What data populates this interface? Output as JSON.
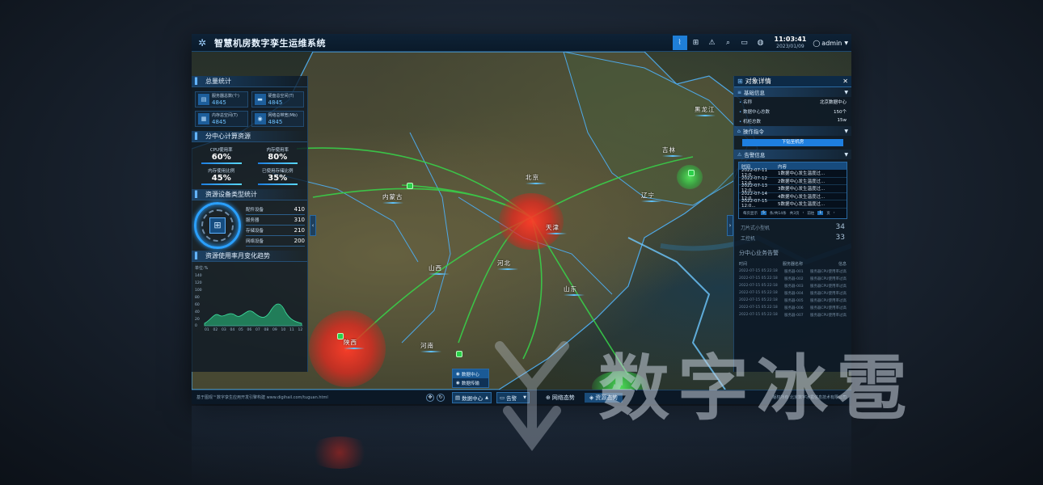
{
  "app": {
    "title": "智慧机房数字孪生运维系统",
    "time": "11:03:41",
    "date": "2023/01/09",
    "user": "admin"
  },
  "left": {
    "total_stats": {
      "heading": "总量统计",
      "items": [
        {
          "label": "服务器总数(个)",
          "value": "4845",
          "icon": "server-icon"
        },
        {
          "label": "硬盘总空间(T)",
          "value": "4845",
          "icon": "disk-icon"
        },
        {
          "label": "内存总空间(T)",
          "value": "4845",
          "icon": "memory-icon"
        },
        {
          "label": "网络总带宽(Mb)",
          "value": "4845",
          "icon": "network-icon"
        }
      ]
    },
    "compute": {
      "heading": "分中心计算资源",
      "items": [
        {
          "label": "CPU使用率",
          "value": "60%"
        },
        {
          "label": "内存使用率",
          "value": "80%"
        },
        {
          "label": "内存使用比例",
          "value": "45%"
        },
        {
          "label": "已使用存储比例",
          "value": "35%"
        }
      ]
    },
    "device_types": {
      "heading": "资源设备类型统计",
      "items": [
        {
          "label": "配件设备",
          "value": "410"
        },
        {
          "label": "服务器",
          "value": "310"
        },
        {
          "label": "存储设备",
          "value": "210"
        },
        {
          "label": "网络设备",
          "value": "200"
        }
      ]
    },
    "trend": {
      "heading": "资源使用率月变化趋势",
      "unit": "单位:%",
      "y_ticks": [
        "140",
        "120",
        "100",
        "80",
        "60",
        "40",
        "20",
        "0"
      ],
      "x_ticks": [
        "01",
        "02",
        "03",
        "04",
        "05",
        "06",
        "07",
        "08",
        "09",
        "10",
        "11",
        "12"
      ]
    }
  },
  "right": {
    "heading": "对象详情",
    "basic": {
      "heading": "基础信息",
      "rows": [
        {
          "k": "名称",
          "v": "北京数据中心"
        },
        {
          "k": "数据中心总数",
          "v": "150个"
        },
        {
          "k": "机柜总数",
          "v": "15w"
        }
      ]
    },
    "command": {
      "heading": "操作指令",
      "button": "下钻至机房"
    },
    "alarm": {
      "heading": "告警信息",
      "columns": [
        "时间",
        "内容"
      ],
      "rows": [
        [
          "2022-07-11 12:0...",
          "1数据中心发生温度过..."
        ],
        [
          "2022-07-12 12:0...",
          "2数据中心发生温度过..."
        ],
        [
          "2022-07-13 12:0...",
          "3数据中心发生温度过..."
        ],
        [
          "2022-07-14 12:0...",
          "4数据中心发生温度过..."
        ],
        [
          "2022-07-15 12:0...",
          "5数据中心发生温度过..."
        ]
      ],
      "pager": {
        "per_page": "每页显示",
        "size": "5",
        "total": "条/共14条",
        "pages": "共3页",
        "prev": "前往",
        "current": "1",
        "unit": "页"
      }
    },
    "dim_stats": [
      {
        "label": "刀片式小型机",
        "value": "34"
      },
      {
        "label": "工控机",
        "value": "33"
      }
    ],
    "biz": {
      "heading": "分中心业务告警",
      "columns": [
        "时间",
        "服务器名称",
        "信息"
      ],
      "rows": [
        [
          "2022-07-15 05:22:18",
          "服务器-001",
          "服务器CPU使用率过高"
        ],
        [
          "2022-07-15 05:22:18",
          "服务器-002",
          "服务器CPU使用率过高"
        ],
        [
          "2022-07-15 05:22:18",
          "服务器-003",
          "服务器CPU使用率过高"
        ],
        [
          "2022-07-15 05:22:18",
          "服务器-004",
          "服务器CPU使用率过高"
        ],
        [
          "2022-07-15 05:22:18",
          "服务器-005",
          "服务器CPU使用率过高"
        ],
        [
          "2022-07-15 05:22:18",
          "服务器-006",
          "服务器CPU使用率过高"
        ],
        [
          "2022-07-15 05:22:18",
          "服务器-007",
          "服务器CPU使用率过高"
        ]
      ]
    }
  },
  "map": {
    "places": [
      {
        "name": "黑龙江",
        "id": "heilongjiang"
      },
      {
        "name": "吉林",
        "id": "jilin"
      },
      {
        "name": "辽宁",
        "id": "liaoning"
      },
      {
        "name": "北京",
        "id": "beijing"
      },
      {
        "name": "内蒙古",
        "id": "neimenggu"
      },
      {
        "name": "河北",
        "id": "hebei"
      },
      {
        "name": "天津",
        "id": "tianjin"
      },
      {
        "name": "山西",
        "id": "shanxi"
      },
      {
        "name": "山东",
        "id": "shandong"
      },
      {
        "name": "河南",
        "id": "henan"
      },
      {
        "name": "陕西",
        "id": "shaanxi"
      }
    ]
  },
  "bottom": {
    "footer_left": "基于图观™数字孪生应用开发引擎构建 www.digihail.com/tuguan.html",
    "footer_right": "版权所有 北京数字冰雹信息技术有限公司",
    "layer_dropdown": "数据中心",
    "alarm_dropdown": "告警",
    "tab_network": "网络态势",
    "tab_resource": "资源态势",
    "menu": [
      "数据中心",
      "数据传输"
    ]
  },
  "watermark": "数字冰雹",
  "colors": {
    "accent": "#1f7fd8",
    "hotspot_red": "#e8321e",
    "hotspot_green": "#3ad24e",
    "panel_bg": "#0a1624"
  }
}
